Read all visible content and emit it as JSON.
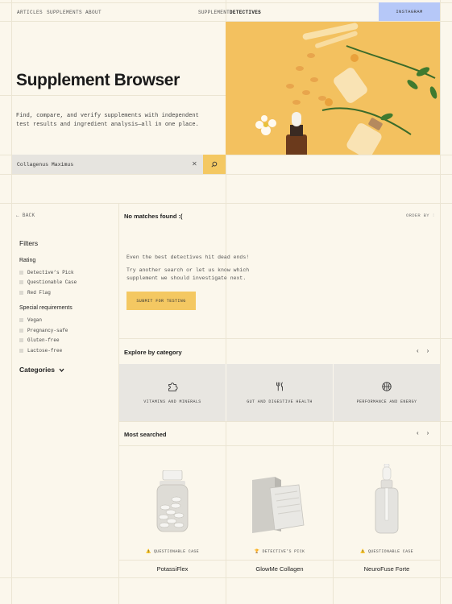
{
  "nav": {
    "links": [
      "ARTICLES",
      "SUPPLEMENTS",
      "ABOUT"
    ],
    "brand_light": "SUPPLEMENT",
    "brand_bold": "DETECTIVES",
    "instagram": "INSTAGRAM"
  },
  "hero": {
    "title": "Supplement Browser",
    "intro": "Find, compare, and verify supplements with independent test results and ingredient analysis—all in one place."
  },
  "search": {
    "value": "Collagenus Maximus",
    "clear_icon": "close-icon",
    "submit_icon": "search-icon"
  },
  "toolbar": {
    "back": "← BACK",
    "no_matches": "No matches found :(",
    "order_by": "ORDER BY"
  },
  "filters": {
    "title": "Filters",
    "rating_label": "Rating",
    "rating_options": [
      "Detective’s Pick",
      "Questionable Case",
      "Red Flag"
    ],
    "special_label": "Special requirements",
    "special_options": [
      "Vegan",
      "Pregnancy-safe",
      "Gluten-free",
      "Lactose-free"
    ],
    "categories_label": "Categories"
  },
  "empty_state": {
    "line1": "Even the best detectives hit dead ends!",
    "line2": "Try another search or let us know which",
    "line3": "supplement we should investigate next.",
    "submit": "SUBMIT FOR TESTING"
  },
  "explore": {
    "title": "Explore by category",
    "categories": [
      {
        "label": "VITAMINS AND MINERALS",
        "icon": "puzzle-icon"
      },
      {
        "label": "GUT AND DIGESTIVE HEALTH",
        "icon": "fork-knife-icon"
      },
      {
        "label": "PERFORMANCE AND ENERGY",
        "icon": "basketball-icon"
      }
    ]
  },
  "most_searched": {
    "title": "Most searched",
    "products": [
      {
        "name": "PotassiFlex",
        "badge": "⚠️ QUESTIONABLE CASE"
      },
      {
        "name": "GlowMe Collagen",
        "badge": "🏆 DETECTIVE’S PICK"
      },
      {
        "name": "NeuroFuse Forte",
        "badge": "⚠️ QUESTIONABLE CASE"
      }
    ]
  },
  "colors": {
    "background": "#fbf7ec",
    "accent_yellow": "#f4c862",
    "instagram_blue": "#b6c8f8",
    "panel_gray": "#e8e6e1"
  }
}
